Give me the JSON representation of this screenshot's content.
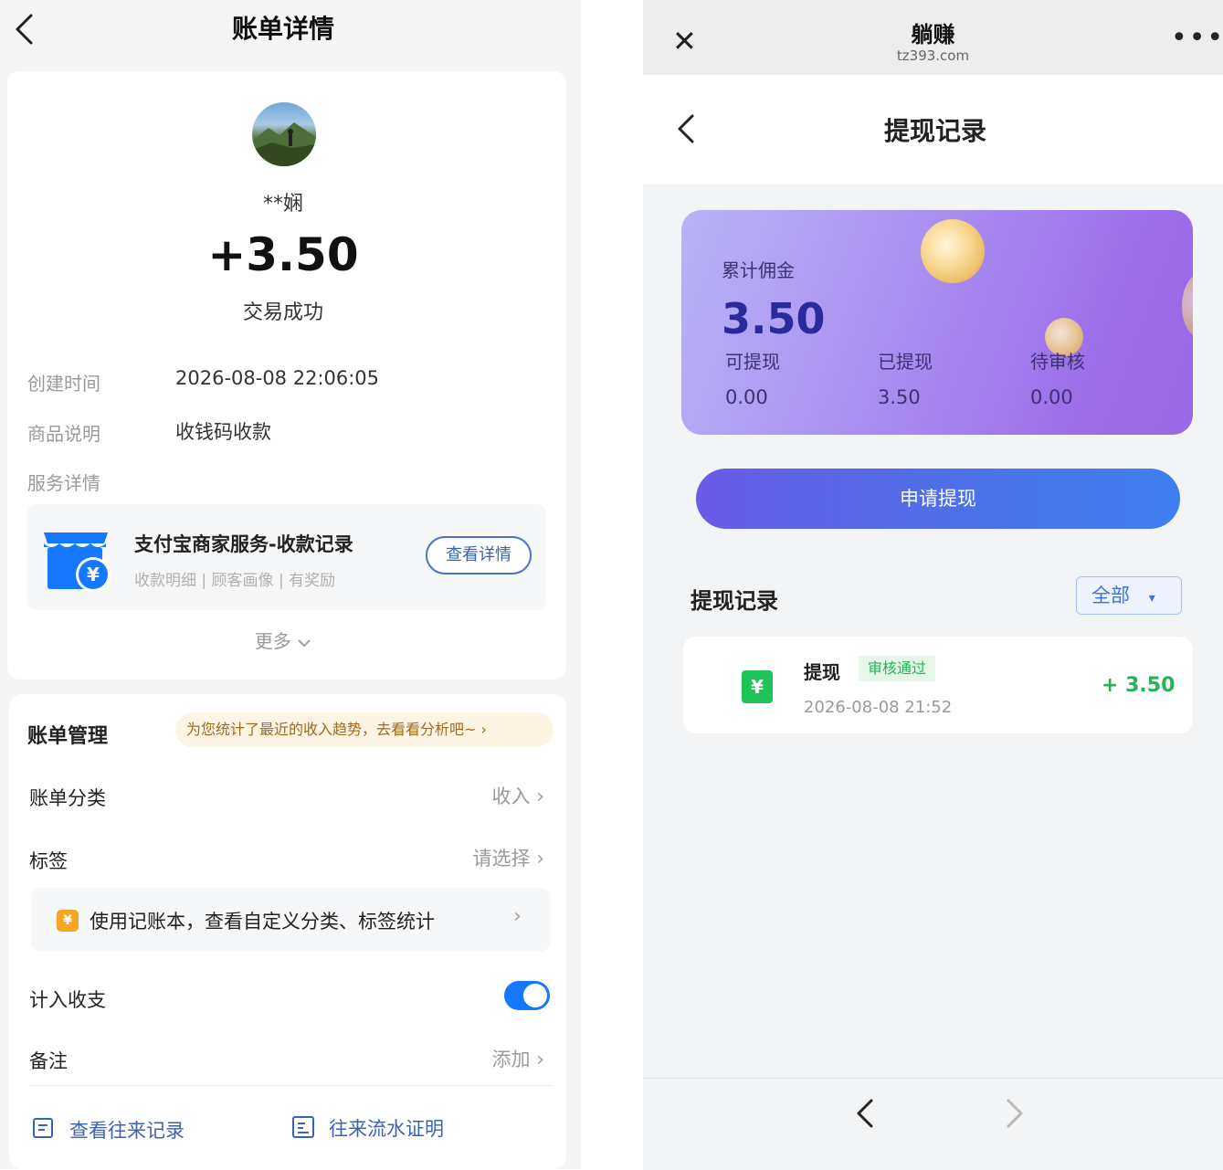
{
  "left": {
    "header_title": "账单详情",
    "payer_name": "**娴",
    "amount": "+3.50",
    "status": "交易成功",
    "details": [
      {
        "label": "创建时间",
        "value": "2026-08-08 22:06:05"
      },
      {
        "label": "商品说明",
        "value": "收钱码收款"
      },
      {
        "label": "服务详情",
        "value": ""
      }
    ],
    "service": {
      "title": "支付宝商家服务-收款记录",
      "subtitle": "收款明细 | 顾客画像 | 有奖励",
      "button": "查看详情"
    },
    "more": "更多",
    "management": {
      "title": "账单管理",
      "tip": "为您统计了最近的收入趋势，去看看分析吧~ ›",
      "rows": [
        {
          "label": "账单分类",
          "value": "收入"
        },
        {
          "label": "标签",
          "value": "请选择"
        }
      ],
      "promo": "使用记账本，查看自定义分类、标签统计",
      "promo_icon": "¥",
      "include_label": "计入收支",
      "note_label": "备注",
      "note_value": "添加"
    },
    "links": [
      {
        "label": "查看往来记录"
      },
      {
        "label": "往来流水证明"
      }
    ]
  },
  "right": {
    "app_title": "躺赚",
    "app_domain": "tz393.com",
    "page_title": "提现记录",
    "card": {
      "total_label": "累计佣金",
      "total_value": "3.50",
      "stats": [
        {
          "label": "可提现",
          "value": "0.00"
        },
        {
          "label": "已提现",
          "value": "3.50"
        },
        {
          "label": "待审核",
          "value": "0.00"
        }
      ]
    },
    "apply_button": "申请提现",
    "records_title": "提现记录",
    "filter": "全部",
    "filter_caret": "▾",
    "record": {
      "name": "提现",
      "badge": "审核通过",
      "date": "2026-08-08 21:52",
      "amount": "+ 3.50",
      "icon": "¥"
    }
  },
  "colors": {
    "accent_blue": "#1677ff",
    "success_green": "#27b354",
    "card_purple": "#a98ef0"
  }
}
